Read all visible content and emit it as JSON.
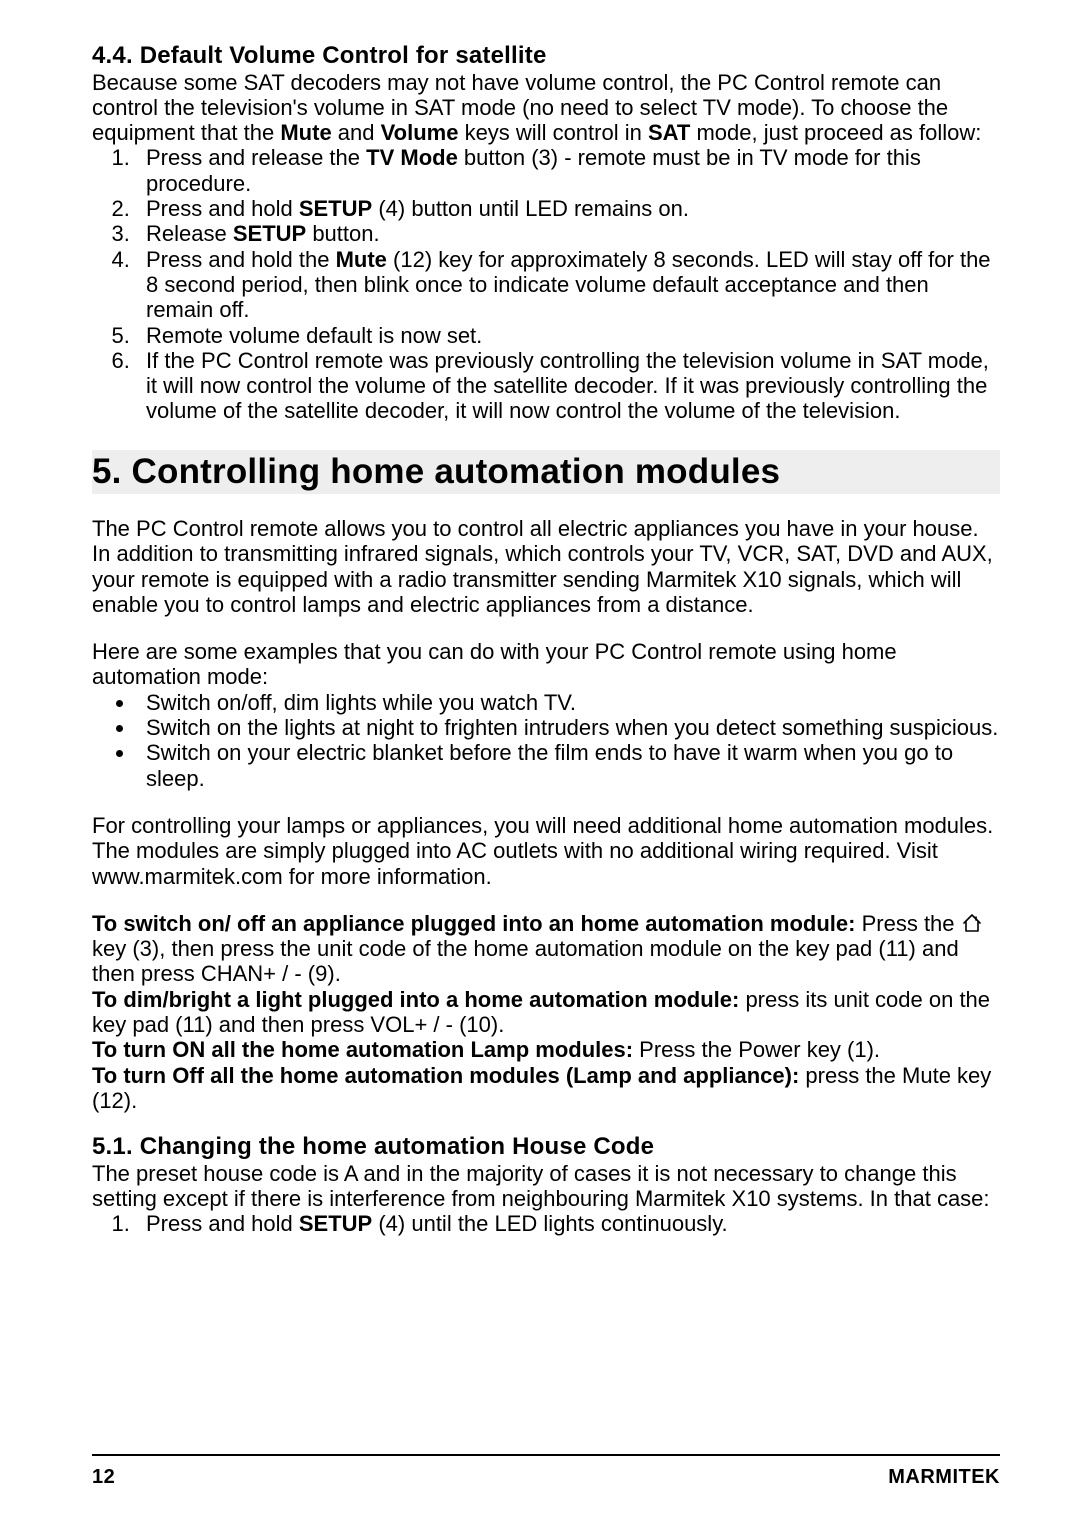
{
  "s44": {
    "heading": "4.4. Default Volume Control for satellite",
    "intro_parts": [
      "Because some SAT decoders may not have volume control, the PC Control remote can control the television's volume in SAT mode (no need to select TV mode). To choose the equipment that the ",
      "Mute",
      " and ",
      "Volume",
      " keys will control in ",
      "SAT",
      " mode, just proceed as follow:"
    ],
    "list": [
      {
        "pre": "Press and release the ",
        "bold": "TV Mode",
        "post": " button (3) - remote must be in TV mode for this procedure."
      },
      {
        "pre": "Press and hold ",
        "bold": "SETUP",
        "post": " (4) button until LED remains on."
      },
      {
        "pre": "Release ",
        "bold": "SETUP",
        "post": " button."
      },
      {
        "pre": "Press and hold the ",
        "bold": "Mute",
        "post": " (12) key for approximately 8 seconds. LED will stay off for the 8 second period, then blink once to indicate volume default acceptance and then remain off."
      },
      {
        "pre": "Remote volume default is now set.",
        "bold": "",
        "post": ""
      },
      {
        "pre": "If the PC Control remote was previously controlling the television volume in SAT mode, it will now control the volume of the satellite decoder. If it was previously controlling the volume of the satellite decoder, it will now control the volume of the television.",
        "bold": "",
        "post": ""
      }
    ]
  },
  "s5": {
    "heading": "5. Controlling home automation modules",
    "para1": "The PC Control remote allows you to control all electric appliances you have in your house. In addition to transmitting infrared signals, which controls your TV, VCR, SAT, DVD and AUX, your remote is equipped with a radio transmitter sending Marmitek X10 signals, which will enable you to control lamps and electric appliances from a distance.",
    "para2": "Here are some examples that you can do with your PC Control remote using home automation mode:",
    "bullets": [
      "Switch on/off, dim lights while you watch TV.",
      "Switch on the lights at night to frighten intruders when you detect something suspicious.",
      "Switch on your electric blanket before the film ends to have it warm when you go to sleep."
    ],
    "para3": "For controlling your lamps or appliances, you will need additional home automation modules. The modules are simply plugged into AC outlets with no additional wiring required. Visit www.marmitek.com for more information.",
    "instr": {
      "switch_on_off_label": "To switch on/ off an appliance plugged into an  home automation module:",
      "switch_on_off_pre": " Press the ",
      "switch_on_off_post": " key (3), then press the unit code of the home automation module on the key pad (11) and then press CHAN+ / - (9).",
      "dim_label": "To dim/bright a light plugged into a home automation module:",
      "dim_text": " press its unit code on the key pad (11) and then press VOL+ / - (10).",
      "turn_on_label": "To turn ON all the home automation Lamp modules:",
      "turn_on_text": " Press the Power key (1).",
      "turn_off_label": "To turn Off all the home automation modules (Lamp and appliance):",
      "turn_off_text": " press the Mute key (12)."
    }
  },
  "s51": {
    "heading": "5.1. Changing the home automation House Code",
    "para": "The preset house code is A and in the majority of cases it is not necessary to change this setting except if there is interference from neighbouring Marmitek X10 systems. In that case:",
    "list": [
      {
        "pre": "Press and hold ",
        "bold": "SETUP",
        "post": " (4) until the LED lights continuously."
      }
    ]
  },
  "footer": {
    "page": "12",
    "brand": "MARMITEK"
  }
}
